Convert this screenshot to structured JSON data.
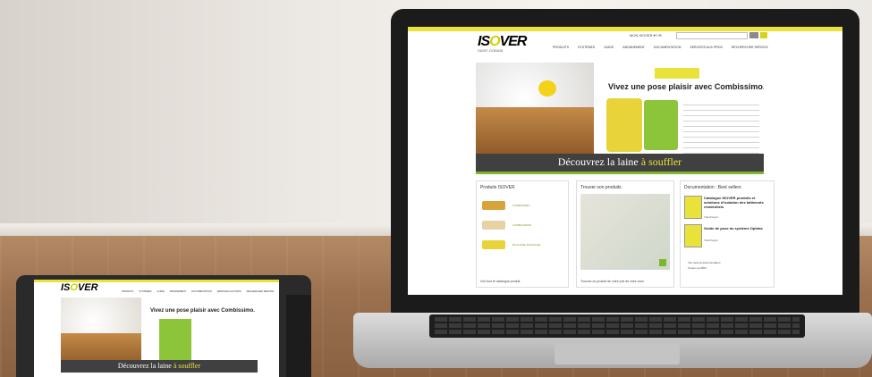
{
  "scene": {
    "brand": "ISOVER",
    "brand_prefix": "IS",
    "brand_o": "O",
    "brand_suffix": "VER",
    "brand_tagline": "SAINT-GOBAIN",
    "colors": {
      "accent": "#e8e23a",
      "green": "#7fb52c",
      "banner": "#404040"
    }
  },
  "laptop": {
    "util_text": "MON ISOVER  ♥  f  ✉",
    "search_placeholder": "",
    "nav": [
      "PRODUITS",
      "SYSTÈMES",
      "GUIDE",
      "ABONNEMENT",
      "DOCUMENTATION",
      "SERVICES AUX PROS",
      "RECHERCHER SERVICE"
    ],
    "hero_title": "Vivez une pose plaisir avec Combissimo.",
    "banner_prefix": "Découvrez la laine ",
    "banner_highlight": "à souffler",
    "col1_head": "Produits ISOVER",
    "col1_products": [
      "COMBISSIMO",
      "COMBLISSIMO",
      "BLOLAINE SOUFFLEE"
    ],
    "col1_foot": "Voir tout le catalogue produit",
    "col2_head": "Trouver son produits",
    "col2_foot": "Trouvez un produit de votre prix de chez vous",
    "col3_head": "Documentation : Best sellers",
    "doc1_title": "Catalogue ISOVER produits et solutions d'isolation des bâtiments résidentiels",
    "doc1_sub": "Télécharger",
    "doc2_title": "Guide de pose du système Optima",
    "doc2_sub": "Télécharger",
    "doc_links": [
      "Voir toute la documentation",
      "Toutes nos BIM"
    ]
  },
  "tablet": {
    "nav": [
      "PRODUITS",
      "SYSTÈMES",
      "GUIDE",
      "ABONNEMENT",
      "DOCUMENTATION",
      "SERVICES AUX PROS",
      "RECHERCHER SERVICE"
    ],
    "hero_title": "Vivez une pose plaisir avec Combissimo.",
    "banner_prefix": "Découvrez la laine ",
    "banner_highlight": "à souffler"
  }
}
